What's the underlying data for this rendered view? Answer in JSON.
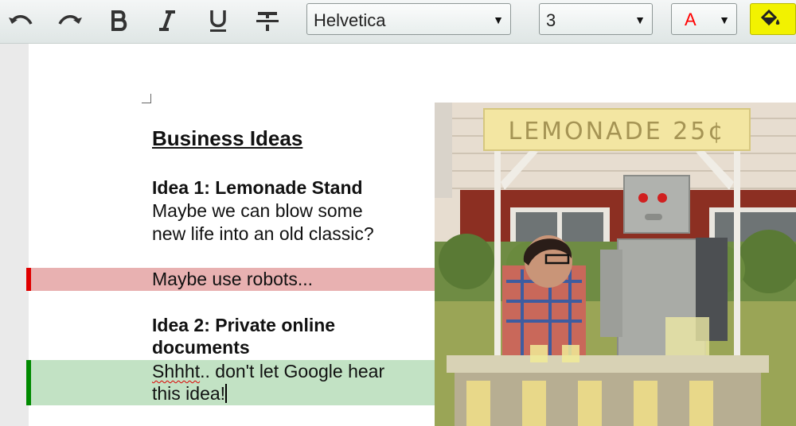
{
  "toolbar": {
    "font_family": "Helvetica",
    "font_size": "3",
    "font_color_label": "A",
    "dropdown_arrow": "▼",
    "icons": [
      "undo-icon",
      "redo-icon",
      "bold-icon",
      "italic-icon",
      "underline-icon",
      "strikethrough-icon",
      "font-color-icon",
      "highlight-color-icon"
    ],
    "font_color": "#ff0000",
    "highlight_color": "#f2f200"
  },
  "document": {
    "title": "Business Ideas",
    "idea1_heading": "Idea 1: Lemonade Stand",
    "idea1_line1": "Maybe we can blow some",
    "idea1_line2": "new life into an old classic?",
    "comment_red": "Maybe use robots...",
    "idea2_heading_line1": "Idea 2: Private online",
    "idea2_heading_line2": "documents",
    "comment_green_word": "Shhht",
    "comment_green_rest": ".. don't let Google hear",
    "comment_green_line2": "this idea!",
    "image": {
      "sign_text": "LEMONADE 25¢",
      "description_icon": "lemonade-stand-photo"
    },
    "colors": {
      "red_highlight": "#e8b1b1",
      "red_marker": "#e00000",
      "green_highlight": "#c2e2c4",
      "green_marker": "#008a00"
    }
  }
}
